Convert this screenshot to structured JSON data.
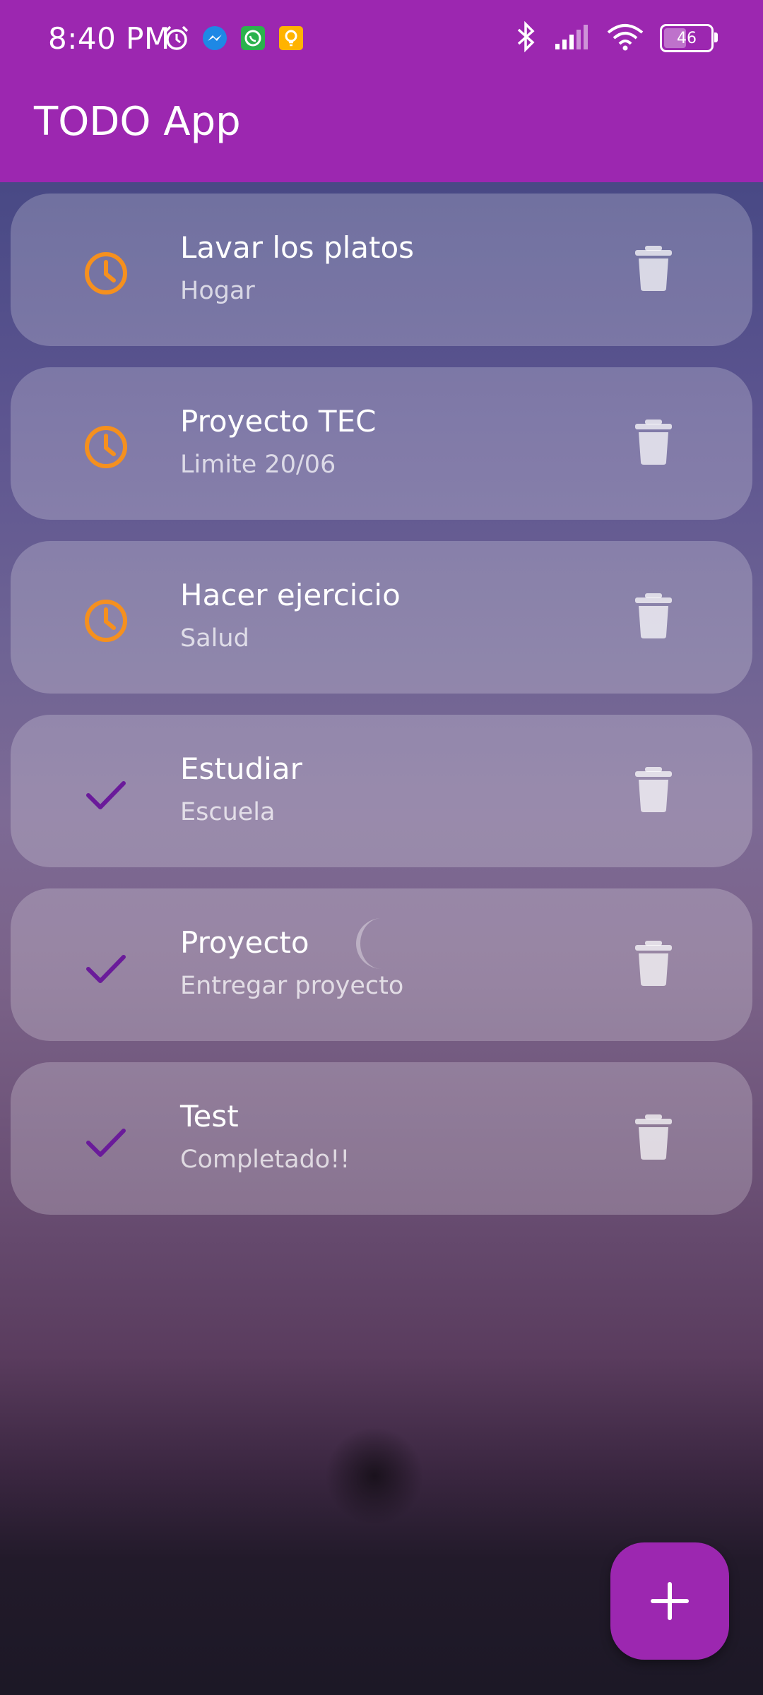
{
  "status_bar": {
    "time": "8:40 PM",
    "battery_level": "46",
    "notification_icons": [
      "alarm-icon",
      "messenger-icon",
      "whatsapp-icon",
      "bulb-icon"
    ],
    "system_icons": [
      "bluetooth-icon",
      "signal-icon",
      "wifi-icon",
      "battery-icon"
    ]
  },
  "app_bar": {
    "title": "TODO App"
  },
  "colors": {
    "primary": "#9c27b0",
    "pending": "#f5901e",
    "done": "#6a1b9a"
  },
  "tasks": [
    {
      "title": "Lavar los platos",
      "subtitle": "Hogar",
      "status": "pending",
      "icon": "clock-icon"
    },
    {
      "title": "Proyecto TEC",
      "subtitle": "Limite 20/06",
      "status": "pending",
      "icon": "clock-icon"
    },
    {
      "title": "Hacer ejercicio",
      "subtitle": "Salud",
      "status": "pending",
      "icon": "clock-icon"
    },
    {
      "title": "Estudiar",
      "subtitle": "Escuela",
      "status": "done",
      "icon": "check-icon"
    },
    {
      "title": "Proyecto",
      "subtitle": "Entregar proyecto",
      "status": "done",
      "icon": "check-icon"
    },
    {
      "title": "Test",
      "subtitle": "Completado!!",
      "status": "done",
      "icon": "check-icon"
    }
  ],
  "fab": {
    "icon": "plus-icon"
  }
}
